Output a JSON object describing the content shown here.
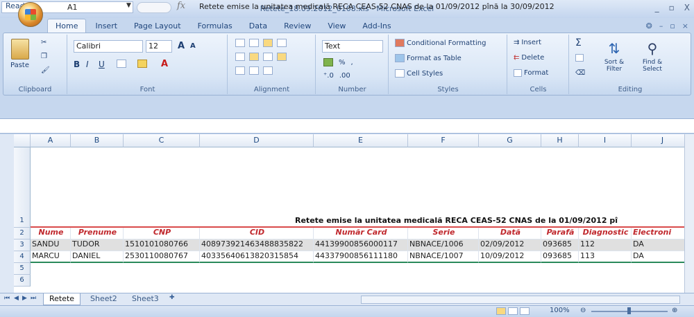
{
  "window": {
    "title": "Retete_18.09.2012_0108.xls - Microsoft Excel",
    "controls": [
      "_",
      "▫",
      "X"
    ]
  },
  "tabs": [
    {
      "label": "Home",
      "active": true
    },
    {
      "label": "Insert"
    },
    {
      "label": "Page Layout"
    },
    {
      "label": "Formulas"
    },
    {
      "label": "Data"
    },
    {
      "label": "Review"
    },
    {
      "label": "View"
    },
    {
      "label": "Add-Ins"
    }
  ],
  "ribbon": {
    "clipboard": {
      "paste": "Paste",
      "label": "Clipboard"
    },
    "font": {
      "name": "Calibri",
      "size": "12",
      "label": "Font",
      "bold": "B",
      "italic": "I",
      "underline": "U",
      "grow": "A",
      "shrink": "A"
    },
    "alignment": {
      "label": "Alignment"
    },
    "number": {
      "format": "Text",
      "label": "Number",
      "percent": "%"
    },
    "styles": {
      "conditional": "Conditional Formatting",
      "table": "Format as Table",
      "cell": "Cell Styles",
      "label": "Styles"
    },
    "cells": {
      "insert": "Insert",
      "delete": "Delete",
      "format": "Format",
      "label": "Cells"
    },
    "editing": {
      "sum": "Σ",
      "sort": "Sort & Filter",
      "find": "Find & Select",
      "label": "Editing"
    }
  },
  "formula_bar": {
    "cell_ref": "A1",
    "fx": "fx",
    "content": "Retete emise la unitatea medicală RECA CEAS-52 CNAS de la 01/09/2012 pînă la 30/09/2012"
  },
  "sheet": {
    "columns": [
      "A",
      "B",
      "C",
      "D",
      "E",
      "F",
      "G",
      "H",
      "I",
      "J"
    ],
    "row_numbers": [
      "1",
      "2",
      "3",
      "4",
      "5",
      "6"
    ],
    "title_cell": "Retete emise la unitatea medicală RECA CEAS-52 CNAS de la 01/09/2012 pî",
    "headers": [
      "Nume",
      "Prenume",
      "CNP",
      "CID",
      "Număr Card",
      "Serie",
      "Dată",
      "Parafă",
      "Diagnostic",
      "Electroni"
    ],
    "rows": [
      [
        "SANDU",
        "TUDOR",
        "1510101080766",
        "408973921463488835822",
        "44139900856000117",
        "NBNACE/1006",
        "02/09/2012",
        "093685",
        "112",
        "DA"
      ],
      [
        "MARCU",
        "DANIEL",
        "2530110080767",
        "40335640613820315854",
        "44337900856111180",
        "NBNACE/1007",
        "10/09/2012",
        "093685",
        "113",
        "DA"
      ]
    ]
  },
  "sheet_tabs": [
    {
      "label": "Retete",
      "active": true
    },
    {
      "label": "Sheet2"
    },
    {
      "label": "Sheet3"
    }
  ],
  "status": {
    "text": "Ready",
    "zoom": "100%"
  }
}
